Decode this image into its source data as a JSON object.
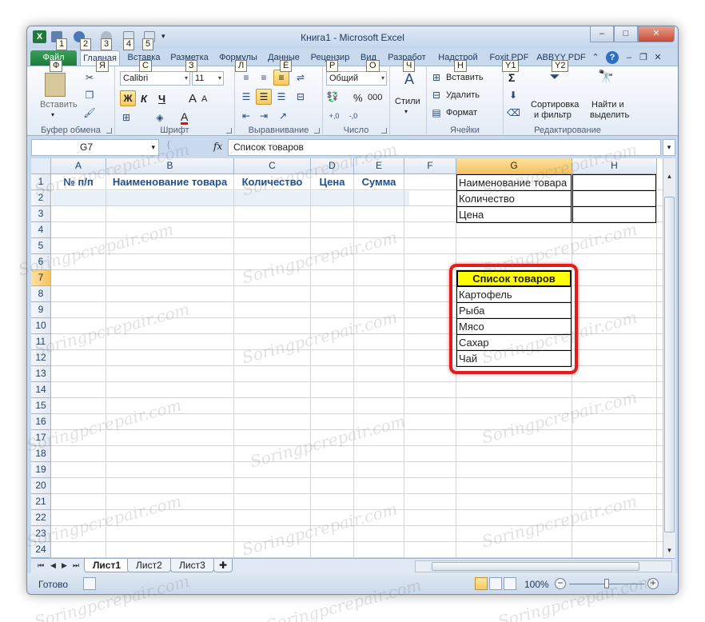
{
  "window": {
    "title": "Книга1 - Microsoft Excel",
    "minimize": "–",
    "maximize": "□",
    "close": "✕"
  },
  "keytips": {
    "qat_save": "1",
    "qat_undo": "2",
    "qat_redo": "3",
    "qat_4": "4",
    "qat_5": "5",
    "file": "Ф",
    "home": "Я",
    "insert": "С",
    "layout": "З",
    "formulas": "Л",
    "data": "Ё",
    "review": "Р",
    "view": "О",
    "developer": "Ч",
    "addins": "Н",
    "foxit": "Y1",
    "abbyy": "Y2"
  },
  "tabs": {
    "file": "Файл",
    "home": "Главная",
    "insert": "Вставка",
    "layout": "Разметка",
    "formulas": "Формулы",
    "data": "Данные",
    "review": "Рецензир",
    "view": "Вид",
    "developer": "Разработ",
    "addins": "Надстрой",
    "foxit": "Foxit PDF",
    "abbyy": "ABBYY PDF"
  },
  "ribbon": {
    "clipboard": {
      "label": "Буфер обмена",
      "paste": "Вставить"
    },
    "font": {
      "label": "Шрифт",
      "font_name": "Calibri",
      "font_size": "11",
      "bold": "Ж",
      "italic": "К",
      "underline": "Ч",
      "grow": "A",
      "shrink": "A",
      "font_color": "A"
    },
    "alignment": {
      "label": "Выравнивание"
    },
    "number": {
      "label": "Число",
      "format": "Общий",
      "percent": "%",
      "comma": "000",
      "inc_dec": ",0\n,00",
      "dec_dec": ",00\n,0"
    },
    "styles": {
      "label": "Стили"
    },
    "cells": {
      "label": "Ячейки",
      "insert": "Вставить",
      "delete": "Удалить",
      "format": "Формат"
    },
    "editing": {
      "label": "Редактирование",
      "sigma": "Σ",
      "sort_filter_1": "Сортировка",
      "sort_filter_2": "и фильтр",
      "find_1": "Найти и",
      "find_2": "выделить"
    }
  },
  "formula_bar": {
    "name_box": "G7",
    "fx": "fx",
    "content": "Список товаров"
  },
  "columns": [
    "A",
    "B",
    "C",
    "D",
    "E",
    "F",
    "G",
    "H"
  ],
  "rows": [
    "1",
    "2",
    "3",
    "4",
    "5",
    "6",
    "7",
    "8",
    "9",
    "10",
    "11",
    "12",
    "13",
    "14",
    "15",
    "16",
    "17",
    "18",
    "19",
    "20",
    "21",
    "22",
    "23",
    "24"
  ],
  "table_headers": {
    "a1": "№ п/п",
    "b1": "Наименование товара",
    "c1": "Количество",
    "d1": "Цена",
    "e1": "Сумма"
  },
  "side_form": {
    "g1": "Наименование товара",
    "g2": "Количество",
    "g3": "Цена"
  },
  "product_list": {
    "title": "Список товаров",
    "items": [
      "Картофель",
      "Рыба",
      "Мясо",
      "Сахар",
      "Чай"
    ]
  },
  "sheets": [
    "Лист1",
    "Лист2",
    "Лист3"
  ],
  "status": {
    "ready": "Готово",
    "zoom": "100%",
    "zoom_out": "−",
    "zoom_in": "+"
  },
  "watermark": "Soringpcrepair.com",
  "colors": {
    "accent_green": "#1d7a3a",
    "highlight_yellow": "#ffff00",
    "frame_red": "#e31b1b",
    "header_blue": "#1f4f8f"
  }
}
